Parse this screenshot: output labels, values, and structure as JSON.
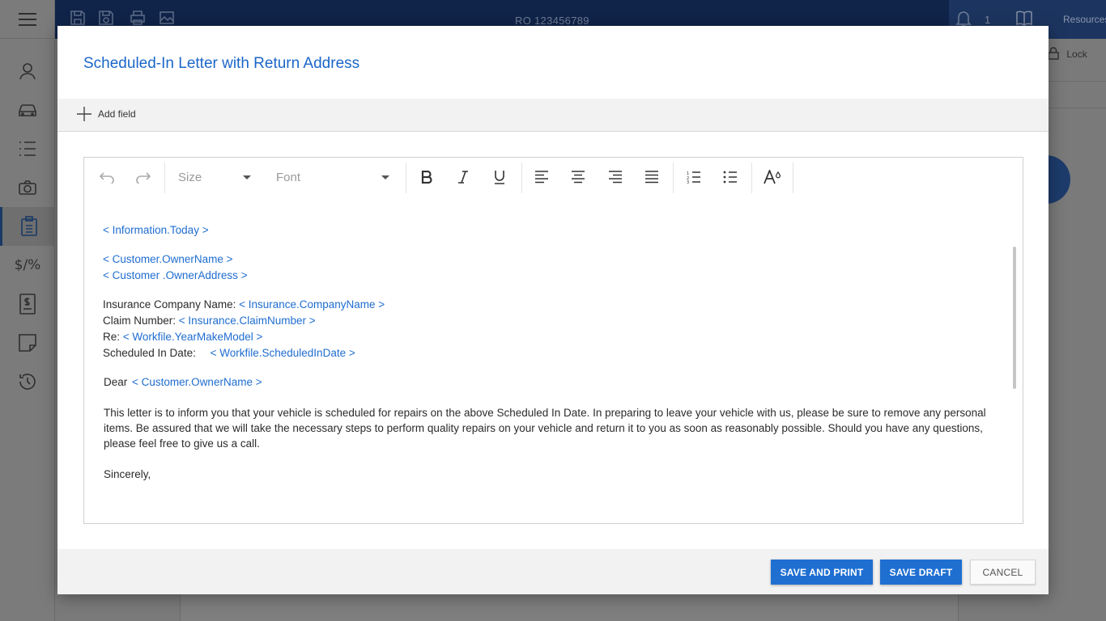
{
  "app": {
    "ro_number": "RO 123456789",
    "notification_count": "1",
    "resources_label": "Resources",
    "lock_label": "Lock",
    "sidebar_icons": [
      "user-icon",
      "car-icon",
      "list-icon",
      "camera-icon",
      "clipboard-icon",
      "dollar-percent-icon",
      "invoice-icon",
      "note-icon",
      "history-icon"
    ],
    "sidebar_pct_label": "$/%"
  },
  "modal": {
    "title": "Scheduled-In Letter with Return Address",
    "add_field_label": "Add field",
    "toolbar": {
      "size_placeholder": "Size",
      "font_placeholder": "Font"
    },
    "letter": {
      "today_tag": "< Information.Today >",
      "owner_name_tag": "< Customer.OwnerName >",
      "owner_address_tag": "< Customer .OwnerAddress >",
      "insurance_label": "Insurance Company Name:",
      "insurance_tag": "< Insurance.CompanyName >",
      "claim_label": "Claim Number:",
      "claim_tag": "< Insurance.ClaimNumber >",
      "re_label": "Re:",
      "re_tag": "< Workfile.YearMakeModel >",
      "scheduled_label": "Scheduled In Date:",
      "scheduled_tag": "< Workfile.ScheduledInDate >",
      "dear_label": "Dear",
      "dear_tag": "< Customer.OwnerName >",
      "body": "This letter is to inform you that your vehicle is scheduled for repairs on the above Scheduled In Date. In preparing to leave your vehicle with us, please be sure to remove any personal items. Be assured that we will take the necessary steps to perform quality repairs on your vehicle and return it to you as soon as reasonably possible. Should you have any questions, please feel free to give us a call.",
      "closing": "Sincerely,"
    },
    "buttons": {
      "save_and_print": "SAVE AND PRINT",
      "save_draft": "SAVE DRAFT",
      "cancel": "CANCEL"
    }
  },
  "colors": {
    "accent": "#1f6fd1",
    "tag": "#1f6dd0",
    "topbar": "#10244a"
  }
}
